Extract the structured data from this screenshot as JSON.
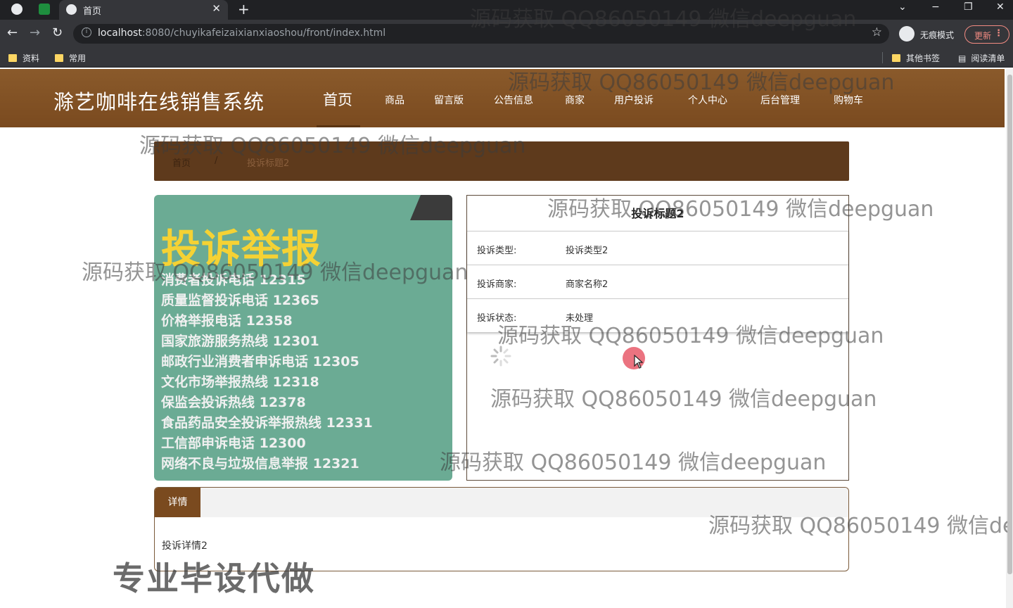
{
  "browser": {
    "tab_title": "首页",
    "url_host": "localhost",
    "url_path": ":8080/chuyikafeizaixianxiaoshou/front/index.html",
    "incognito_label": "无痕模式",
    "update_label": "更新",
    "bookmarks": [
      "资料",
      "常用"
    ],
    "other_bookmarks": "其他书签",
    "reading_list": "阅读清单"
  },
  "site": {
    "logo": "滁艺咖啡在线销售系统",
    "nav": [
      "首页",
      "商品",
      "留言版",
      "公告信息",
      "商家",
      "用户投诉",
      "个人中心",
      "后台管理",
      "购物车"
    ]
  },
  "breadcrumb": {
    "home": "首页",
    "sep": "/",
    "current": "投诉标题2"
  },
  "poster": {
    "headline": "投诉举报",
    "lines": [
      "消费者投诉电话 12315",
      "质量监督投诉电话 12365",
      "价格举报电话 12358",
      "国家旅游服务热线 12301",
      "邮政行业消费者申诉电话 12305",
      "文化市场举报热线 12318",
      "保监会投诉热线 12378",
      "食品药品安全投诉举报热线 12331",
      "工信部申诉电话 12300",
      "网络不良与垃圾信息举报 12321"
    ]
  },
  "detail": {
    "title": "投诉标题2",
    "rows": [
      {
        "label": "投诉类型:",
        "value": "投诉类型2"
      },
      {
        "label": "投诉商家:",
        "value": "商家名称2"
      },
      {
        "label": "投诉状态:",
        "value": "未处理"
      }
    ]
  },
  "tabs": {
    "active": "详情",
    "content": "投诉详情2"
  },
  "watermark": "源码获取 QQ86050149 微信deepguan",
  "watermark_big": "专业毕设代做",
  "colors": {
    "header_brown": "#7a4a1f",
    "breadcrumb_brown": "#5e3a1c",
    "poster_green": "#6bab94",
    "headline_yellow": "#f5d234"
  }
}
